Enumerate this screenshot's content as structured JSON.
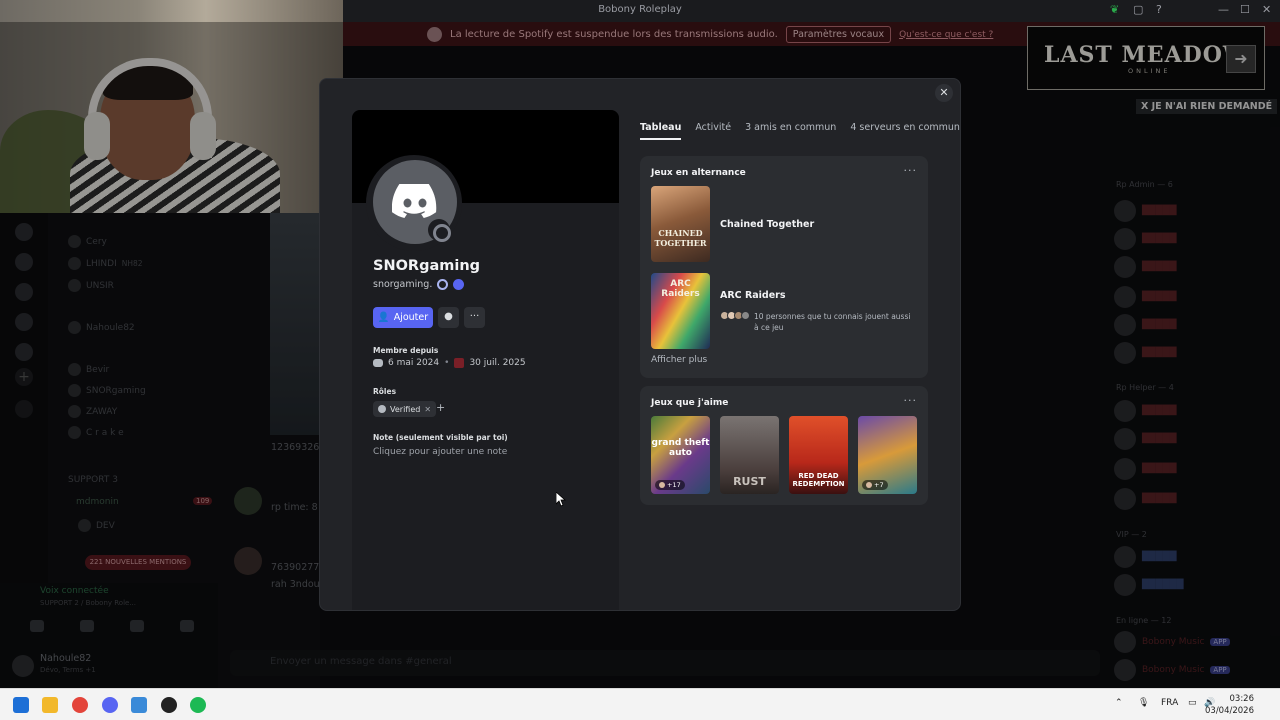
{
  "window": {
    "title": "Bobony Roleplay"
  },
  "notice": {
    "text": "La lecture de Spotify est suspendue lors des transmissions audio.",
    "button": "Paramètres vocaux",
    "link": "Qu'est-ce que c'est ?"
  },
  "overlay": {
    "title": "LAST MEADOW",
    "subtitle": "ONLINE",
    "tag": "X JE N'AI RIEN DEMANDÉ"
  },
  "profile": {
    "display_name": "SNORgaming",
    "username": "snorgaming.",
    "add_button": "Ajouter",
    "member_since_label": "Membre depuis",
    "discord_since": "6 mai 2024",
    "server_since": "30 juil. 2025",
    "roles_label": "Rôles",
    "roles": [
      {
        "name": "Verified"
      }
    ],
    "note_label": "Note (seulement visible par toi)",
    "note_placeholder": "Cliquez pour ajouter une note",
    "status": "offline"
  },
  "tabs": [
    {
      "label": "Tableau",
      "active": true
    },
    {
      "label": "Activité",
      "active": false
    },
    {
      "label": "3 amis en commun",
      "active": false
    },
    {
      "label": "4 serveurs en commun",
      "active": false
    }
  ],
  "rotation": {
    "title": "Jeux en alternance",
    "games": [
      {
        "name": "Chained Together",
        "cover_text": "CHAINED TOGETHER"
      },
      {
        "name": "ARC Raiders",
        "cover_text": "ARC Raiders"
      }
    ],
    "friends_text": "10 personnes que tu connais jouent aussi à ce jeu",
    "show_more": "Afficher plus"
  },
  "likes": {
    "title": "Jeux que j'aime",
    "tiles": [
      {
        "label": "grand theft auto",
        "badge": "+17"
      },
      {
        "label": "RUST",
        "badge": ""
      },
      {
        "label": "RED DEAD REDEMPTION",
        "badge": ""
      },
      {
        "label": "",
        "badge": "+7"
      }
    ]
  },
  "background": {
    "channels": [
      "SNORgaming",
      "Bevir",
      "Nahoule82",
      "ZAWAY",
      "C r a k e",
      "UNSIR",
      "LHINDI",
      "Cery"
    ],
    "mentions": "221 NOUVELLES MENTIONS",
    "section": "SUPPORT 3",
    "user_channel": "mdmonin",
    "user_badge": "109",
    "dev": "DEV",
    "voice_connected": "Voix connectée",
    "voice_channel": "SUPPORT 2 / Bobony Role...",
    "user_name": "Nahoule82",
    "user_status": "Dévo, Terms +1",
    "chat_snips": [
      "123693268",
      "rp time: 8",
      "763902777",
      "rah 3ndou"
    ],
    "composer_placeholder": "Envoyer un message dans #general",
    "members": {
      "groups": [
        "Rp Admin — 6",
        "Rp Helper — 4",
        "VIP — 2",
        "En ligne — 12"
      ],
      "bots": [
        "Bobony Music",
        "Bobony Music"
      ],
      "app_tag": "APP"
    }
  },
  "taskbar": {
    "lang": "FRA",
    "time": "03:26",
    "date": "03/04/2026"
  },
  "colors": {
    "accent": "#5865f2",
    "modal_bg": "#222327",
    "card_bg": "#2b2d31",
    "notice_bg": "#3f1418"
  }
}
